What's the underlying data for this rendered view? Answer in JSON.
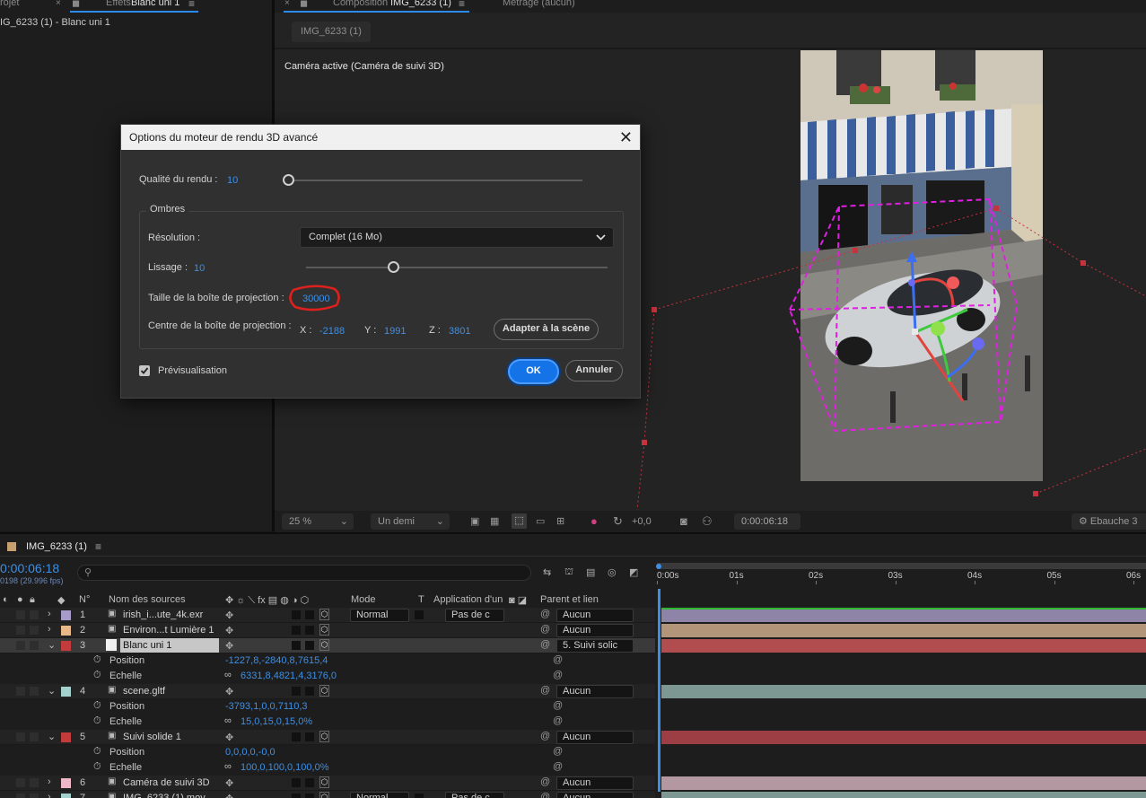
{
  "tabs": {
    "project_tab": "rojet",
    "effects_prefix": "Effets",
    "effects_active": "Blanc uni 1",
    "composition_prefix": "Composition",
    "composition_active": "IMG_6233 (1)",
    "footage_tab": "Métrage (aucun)"
  },
  "left_panel": {
    "breadcrumb": "IG_6233 (1) - Blanc uni 1"
  },
  "viewer": {
    "comp_chip": "IMG_6233 (1)",
    "camera_label": "Caméra active (Caméra de suivi 3D)",
    "bottom_bar": {
      "zoom": "25 %",
      "resolution": "Un demi",
      "exposure": "+0,0",
      "timecode": "0:00:06:18",
      "renderer": "Ebauche 3"
    }
  },
  "dialog": {
    "title": "Options du moteur de rendu 3D avancé",
    "quality_label": "Qualité du rendu :",
    "quality_value": "10",
    "quality_slider": 0,
    "shadows_group": "Ombres",
    "resolution_label": "Résolution :",
    "resolution_value": "Complet (16 Mo)",
    "smoothing_label": "Lissage :",
    "smoothing_value": "10",
    "smoothing_slider": 0.29,
    "projection_size_label": "Taille de la boîte de projection :",
    "projection_size_value": "30000",
    "projection_center_label": "Centre de la boîte de projection :",
    "center_x_label": "X :",
    "center_x": "-2188",
    "center_y_label": "Y :",
    "center_y": "1991",
    "center_z_label": "Z :",
    "center_z": "3801",
    "fit_button": "Adapter à la scène",
    "preview_label": "Prévisualisation",
    "ok_label": "OK",
    "cancel_label": "Annuler"
  },
  "timeline": {
    "comp_name": "IMG_6233 (1)",
    "current_time": "0:00:06:18",
    "frame_info": "0198 (29.996 fps)",
    "search_placeholder": "",
    "headers": {
      "num": "N°",
      "source": "Nom des sources",
      "mode": "Mode",
      "t": "T",
      "matte": "Application d'un c...",
      "parent": "Parent et lien"
    },
    "ruler": [
      "0:00s",
      "01s",
      "02s",
      "03s",
      "04s",
      "05s",
      "06s"
    ],
    "layers": [
      {
        "num": "1",
        "name": "irish_i...ute_4k.exr",
        "mode": "Normal",
        "matte": "Pas de c",
        "parent": "Aucun",
        "color": "#a79bc9",
        "bar": "#8e84a8"
      },
      {
        "num": "2",
        "name": "Environ...t Lumière 1",
        "parent": "Aucun",
        "color": "#e8b889",
        "bar": "#b3957a"
      },
      {
        "num": "3",
        "name": "Blanc uni 1",
        "parent": "5. Suivi solic",
        "color": "#c43b3b",
        "bar": "#b14c4f"
      },
      {
        "num": "4",
        "name": "scene.gltf",
        "parent": "Aucun",
        "color": "#a4d1cc",
        "bar": "#7d9793"
      },
      {
        "num": "5",
        "name": "Suivi solide 1",
        "parent": "Aucun",
        "color": "#c43b3b",
        "bar": "#9c3e43"
      },
      {
        "num": "6",
        "name": "Caméra de suivi 3D",
        "parent": "Aucun",
        "color": "#efb8c8",
        "bar": "#b398a1"
      },
      {
        "num": "7",
        "name": "IMG_6233 (1).mov",
        "mode": "Normal",
        "matte": "Pas de c",
        "parent": "Aucun",
        "color": "#a4d1cc",
        "bar": "#7d9793"
      }
    ],
    "props": {
      "position_label": "Position",
      "scale_label": "Echelle",
      "l3_position": "-1227,8,-2840,8,7615,4",
      "l3_scale": "6331,8,4821,4,3176,0",
      "l4_position": "-3793,1,0,0,7110,3",
      "l4_scale": "15,0,15,0,15,0",
      "l4_scale_unit": "%",
      "l5_position": "0,0,0,0,-0,0",
      "l5_scale": "100,0,100,0,100,0",
      "l5_scale_unit": "%"
    }
  },
  "colors": {
    "accent": "#1473e6",
    "value_blue": "#3d8fe6",
    "gizmo": "#e020e0",
    "tracker": "#c8323c"
  }
}
